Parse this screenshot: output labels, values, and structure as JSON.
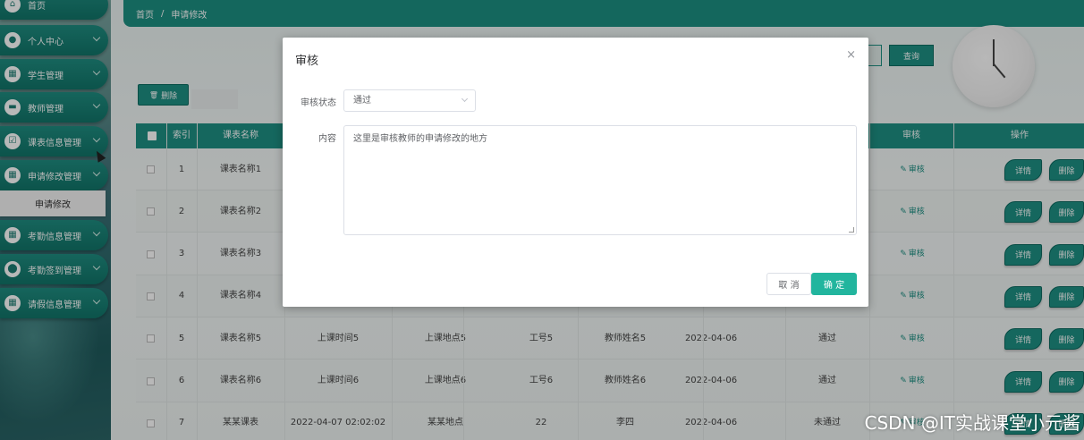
{
  "sidebar": {
    "items": [
      {
        "label": "首页",
        "icon": "home-icon",
        "glyph": "⌂",
        "chevron": false
      },
      {
        "label": "个人中心",
        "icon": "person-icon",
        "glyph": "●",
        "chevron": true
      },
      {
        "label": "学生管理",
        "icon": "grid-icon",
        "glyph": "▦",
        "chevron": true
      },
      {
        "label": "教师管理",
        "icon": "book-icon",
        "glyph": "▬",
        "chevron": true
      },
      {
        "label": "课表信息管理",
        "icon": "checklist-icon",
        "glyph": "☑",
        "chevron": true
      },
      {
        "label": "申请修改管理",
        "icon": "grid-icon",
        "glyph": "▦",
        "chevron": true
      },
      {
        "label": "考勤信息管理",
        "icon": "grid-icon",
        "glyph": "▦",
        "chevron": true
      },
      {
        "label": "考勤签到管理",
        "icon": "location-icon",
        "glyph": "⬤",
        "chevron": true
      },
      {
        "label": "请假信息管理",
        "icon": "grid-icon",
        "glyph": "▦",
        "chevron": true
      }
    ],
    "subitem": "申请修改"
  },
  "breadcrumb": {
    "home": "首页",
    "sep": "/",
    "current": "申请修改"
  },
  "toolbar": {
    "delete_label": "删除",
    "delete_icon": "🗑",
    "query_label": "查询"
  },
  "table": {
    "headers": [
      "索引",
      "课表名称",
      "审核",
      "操作"
    ],
    "rows": [
      {
        "index": "1",
        "name": "课表名称1",
        "time": "",
        "place": "",
        "teacher_no": "",
        "teacher": "",
        "date": "",
        "status": ""
      },
      {
        "index": "2",
        "name": "课表名称2",
        "time": "",
        "place": "",
        "teacher_no": "",
        "teacher": "",
        "date": "",
        "status": ""
      },
      {
        "index": "3",
        "name": "课表名称3",
        "time": "",
        "place": "",
        "teacher_no": "",
        "teacher": "",
        "date": "",
        "status": ""
      },
      {
        "index": "4",
        "name": "课表名称4",
        "time": "",
        "place": "",
        "teacher_no": "",
        "teacher": "",
        "date": "",
        "status": ""
      },
      {
        "index": "5",
        "name": "课表名称5",
        "time": "上课时间5",
        "place": "上课地点5",
        "teacher_no": "工号5",
        "teacher": "教师姓名5",
        "date": "2022-04-06",
        "status": "通过"
      },
      {
        "index": "6",
        "name": "课表名称6",
        "time": "上课时间6",
        "place": "上课地点6",
        "teacher_no": "工号6",
        "teacher": "教师姓名6",
        "date": "2022-04-06",
        "status": "通过"
      },
      {
        "index": "7",
        "name": "某某课表",
        "time": "2022-04-07 02:02:02",
        "place": "某某地点",
        "teacher_no": "22",
        "teacher": "李四",
        "date": "2022-04-06",
        "status": "未通过"
      }
    ],
    "audit_link": "审核",
    "detail_label": "详情",
    "delete_label": "删除"
  },
  "dialog": {
    "title": "审核",
    "close": "×",
    "status_label": "审核状态",
    "status_value": "通过",
    "content_label": "内容",
    "content_value": "这里是审核教师的申请修改的地方",
    "cancel_label": "取 消",
    "confirm_label": "确 定"
  },
  "watermark": "CSDN @IT实战课堂小元酱",
  "colors": {
    "primary": "#1e8f83",
    "confirm": "#22b59e"
  }
}
